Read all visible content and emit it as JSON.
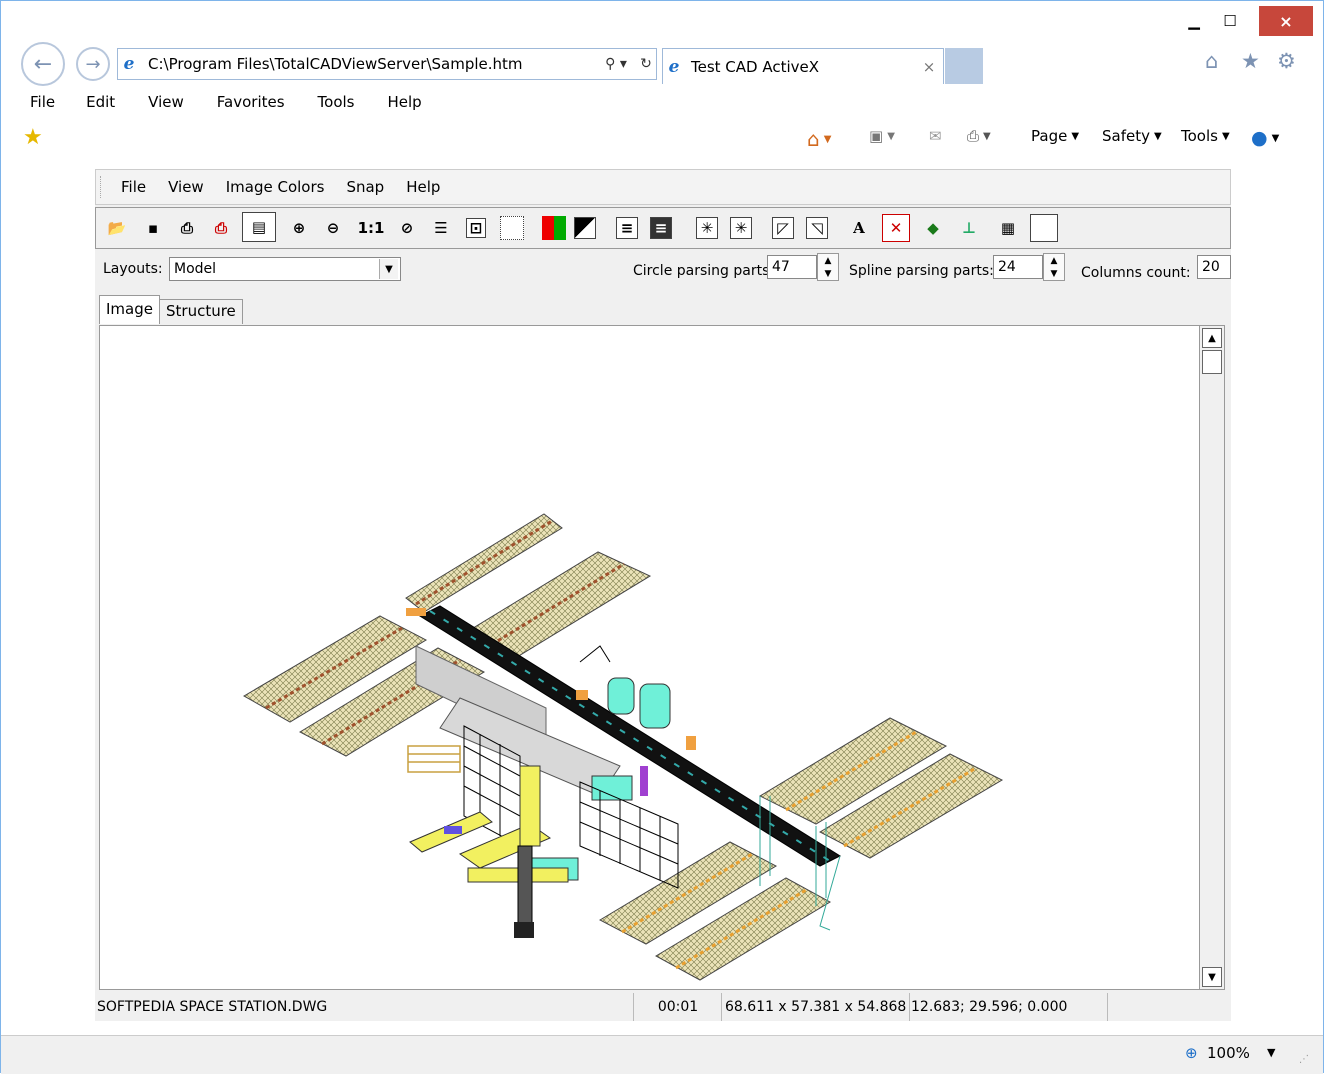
{
  "window": {
    "min_icon": "minimize-icon",
    "max_icon": "maximize-icon",
    "close_label": "×"
  },
  "address": {
    "url": "C:\\Program Files\\TotalCADViewServer\\Sample.htm",
    "search_icon": "⚲ ▾",
    "refresh_icon": "↻"
  },
  "tab": {
    "title": "Test CAD ActiveX",
    "close": "×"
  },
  "browser_icons": {
    "home": "⌂",
    "favorites": "★",
    "settings": "⚙"
  },
  "menu": [
    "File",
    "Edit",
    "View",
    "Favorites",
    "Tools",
    "Help"
  ],
  "commands": {
    "page": "Page",
    "safety": "Safety",
    "tools": "Tools"
  },
  "ax_menu": [
    "File",
    "View",
    "Image Colors",
    "Snap",
    "Help"
  ],
  "layouts": {
    "label": "Layouts:",
    "value": "Model"
  },
  "params": {
    "circle_label": "Circle parsing parts:",
    "circle_value": "47",
    "spline_label": "Spline parsing parts:",
    "spline_value": "24",
    "columns_label": "Columns count:",
    "columns_value": "20"
  },
  "view_tabs": [
    "Image",
    "Structure"
  ],
  "status": {
    "file": "SOFTPEDIA SPACE STATION.DWG",
    "time": "00:01",
    "dims": "68.611 x 57.381 x 54.868",
    "coords": "12.683; 29.596; 0.000"
  },
  "zoom": "100%",
  "toolbar": {
    "one_to_one": "1:1",
    "text_tool": "A"
  },
  "colors": {
    "title_close": "#c7473b",
    "accent": "#1e6fc8"
  }
}
